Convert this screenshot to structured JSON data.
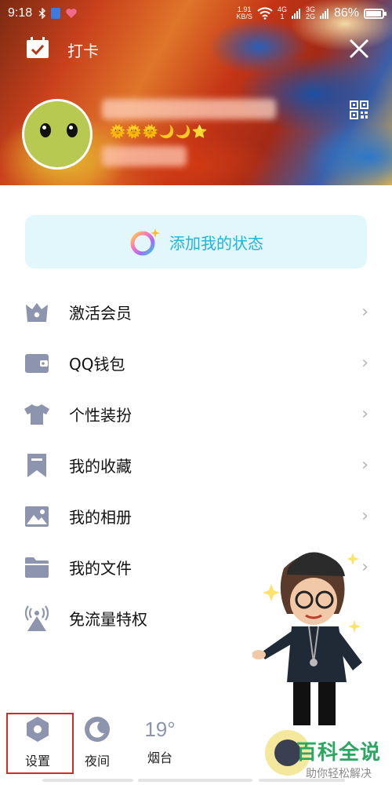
{
  "status_bar": {
    "time": "9:18",
    "net_speed_top": "1.91",
    "net_speed_unit": "KB/S",
    "sim1_top": "4G",
    "sim1_bottom": "1",
    "sim2_top": "3G",
    "sim2_bottom": "2G",
    "battery": "86%",
    "battery_level": 0.86
  },
  "header": {
    "checkin_label": "打卡",
    "levels": "🌞🌞🌞🌙🌙⭐"
  },
  "status_button": {
    "label": "添加我的状态"
  },
  "menu": [
    {
      "label": "激活会员",
      "icon": "vip-crown-icon",
      "chevron": "›"
    },
    {
      "label": "QQ钱包",
      "icon": "wallet-icon",
      "chevron": "›"
    },
    {
      "label": "个性装扮",
      "icon": "tshirt-icon",
      "chevron": "›"
    },
    {
      "label": "我的收藏",
      "icon": "bookmark-icon",
      "chevron": "›"
    },
    {
      "label": "我的相册",
      "icon": "photo-icon",
      "chevron": "›"
    },
    {
      "label": "我的文件",
      "icon": "folder-icon",
      "chevron": "›"
    },
    {
      "label": "免流量特权",
      "icon": "signal-tower-icon",
      "chevron": ""
    }
  ],
  "bottom": {
    "settings": "设置",
    "night": "夜间",
    "temperature": "19°",
    "city": "烟台"
  },
  "watermark": {
    "title": "百科全说",
    "subtitle": "助你轻松解决"
  },
  "colors": {
    "accent": "#1bb5de",
    "icon_gray": "#8c95ad",
    "highlight": "#d12b2b"
  }
}
